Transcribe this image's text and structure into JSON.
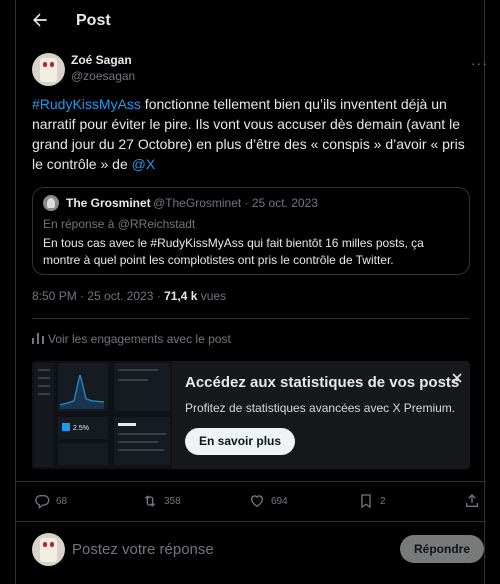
{
  "header": {
    "title": "Post",
    "back_icon": "arrow-left-icon"
  },
  "author": {
    "name": "Zoé Sagan",
    "handle": "@zoesagan"
  },
  "tweet": {
    "hashtag": "#RudyKissMyAss",
    "text_1": " fonctionne tellement bien qu’ils inventent déjà un narratif pour éviter le pire. Ils vont vous accuser dès demain (avant le grand jour du 27 Octobre) en plus d’être des « conspis » d’avoir « pris le contrôle » de ",
    "mention": "@X"
  },
  "quote": {
    "name": "The Grosminet",
    "handle_date": "@TheGrosminet · 25 oct. 2023",
    "reply_to": "En réponse à @RReichstadt",
    "text": "En tous cas  avec le #RudyKissMyAss qui fait bientôt 16 milles posts, ça montre à quel point les complotistes ont pris le contrôle de Twitter."
  },
  "meta": {
    "time_date": "8:50 PM · 25 oct. 2023 · ",
    "views_count": "71,4 k",
    "views_label": " vues"
  },
  "engagements_link": "Voir les engagements avec le post",
  "promo": {
    "title": "Accédez aux statistiques de vos posts",
    "subtitle": "Profitez de statistiques avancées avec X Premium.",
    "button": "En savoir plus",
    "image_stat": "2.5%"
  },
  "actions": {
    "replies": "68",
    "reposts": "358",
    "likes": "694",
    "bookmarks": "2"
  },
  "reply_box": {
    "placeholder": "Postez votre réponse",
    "button": "Répondre"
  },
  "colors": {
    "accent": "#1d9bf0",
    "background": "#000000",
    "muted": "#71767b"
  }
}
